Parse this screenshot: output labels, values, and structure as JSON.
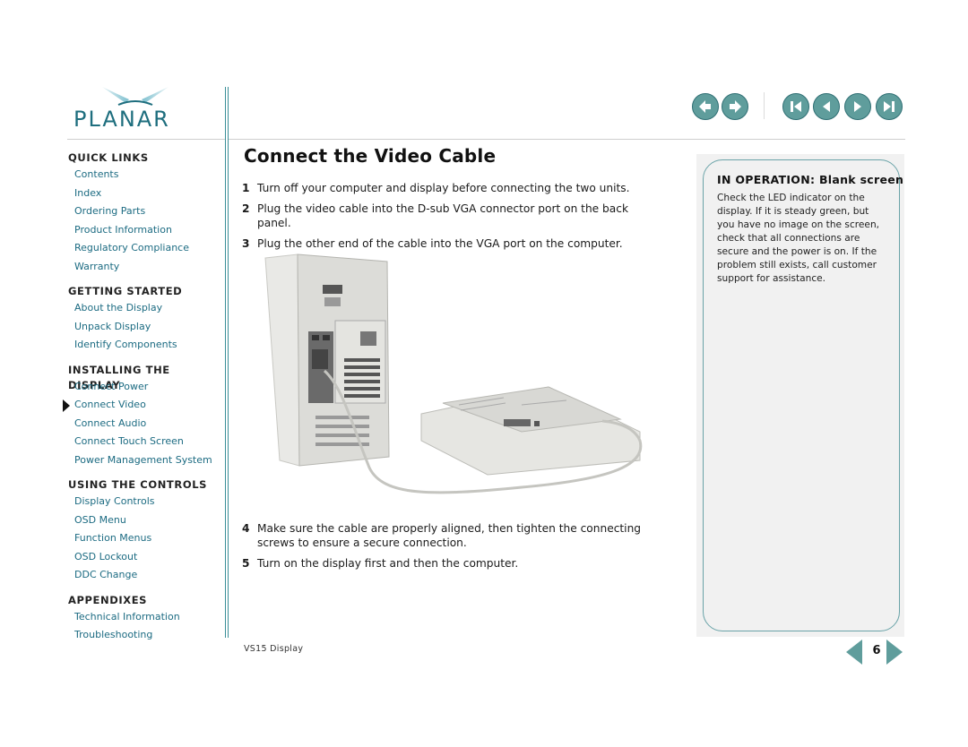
{
  "brand": {
    "name": "PLANAR",
    "logo_icon": "planar-logo-icon"
  },
  "colors": {
    "accent": "#1c6b82",
    "nav_button": "#5f9d9c",
    "rule": "#3a8f98",
    "box_border": "#6aa3a8",
    "box_bg": "#f1f1f1"
  },
  "top_nav": {
    "history": [
      {
        "name": "back-button",
        "icon": "arrow-left-icon"
      },
      {
        "name": "forward-button",
        "icon": "arrow-right-icon"
      }
    ],
    "paging": [
      {
        "name": "first-page-button",
        "icon": "first-page-icon"
      },
      {
        "name": "previous-page-button",
        "icon": "triangle-left-icon"
      },
      {
        "name": "next-page-button",
        "icon": "triangle-right-icon"
      },
      {
        "name": "last-page-button",
        "icon": "last-page-icon"
      }
    ]
  },
  "sidebar": {
    "sections": [
      {
        "title": "QUICK LINKS",
        "items": [
          "Contents",
          "Index",
          "Ordering Parts",
          "Product Information",
          "Regulatory Compliance",
          "Warranty"
        ]
      },
      {
        "title": "GETTING STARTED",
        "items": [
          "About the Display",
          "Unpack Display",
          "Identify Components"
        ]
      },
      {
        "title": "INSTALLING THE DISPLAY",
        "items": [
          "Connect Power",
          "Connect Video",
          "Connect Audio",
          "Connect Touch Screen",
          "Power Management System"
        ]
      },
      {
        "title": "USING THE CONTROLS",
        "items": [
          "Display Controls",
          "OSD Menu",
          "Function Menus",
          "OSD Lockout",
          "DDC Change"
        ]
      },
      {
        "title": "APPENDIXES",
        "items": [
          "Technical Information",
          "Troubleshooting"
        ]
      }
    ],
    "current_item": "Connect Video"
  },
  "main": {
    "title": "Connect the Video Cable",
    "steps_before_figure": [
      {
        "num": "1",
        "text": "Turn off your computer and display before connecting the two units."
      },
      {
        "num": "2",
        "text": "Plug the video cable into the D-sub VGA connector port on the back panel."
      },
      {
        "num": "3",
        "text": "Plug the other end of the cable into the VGA port on the computer."
      }
    ],
    "figure": {
      "description": "Computer tower connected by VGA cable to the back of a flat-panel display lying face down"
    },
    "steps_after_figure": [
      {
        "num": "4",
        "text": "Make sure the cable are properly aligned, then tighten the connecting screws to ensure a secure connection."
      },
      {
        "num": "5",
        "text": "Turn on the display first and then the computer."
      }
    ]
  },
  "info_box": {
    "heading_prefix": "IN OPERATION:",
    "heading_topic": "Blank screen",
    "body": "Check the LED indicator on the display. If it is steady green, but you have no image on the screen, check that all connections are secure and the power is on. If the problem still exists, call customer support for assistance."
  },
  "footer": {
    "label": "VS15 Display",
    "page_number": "6"
  }
}
